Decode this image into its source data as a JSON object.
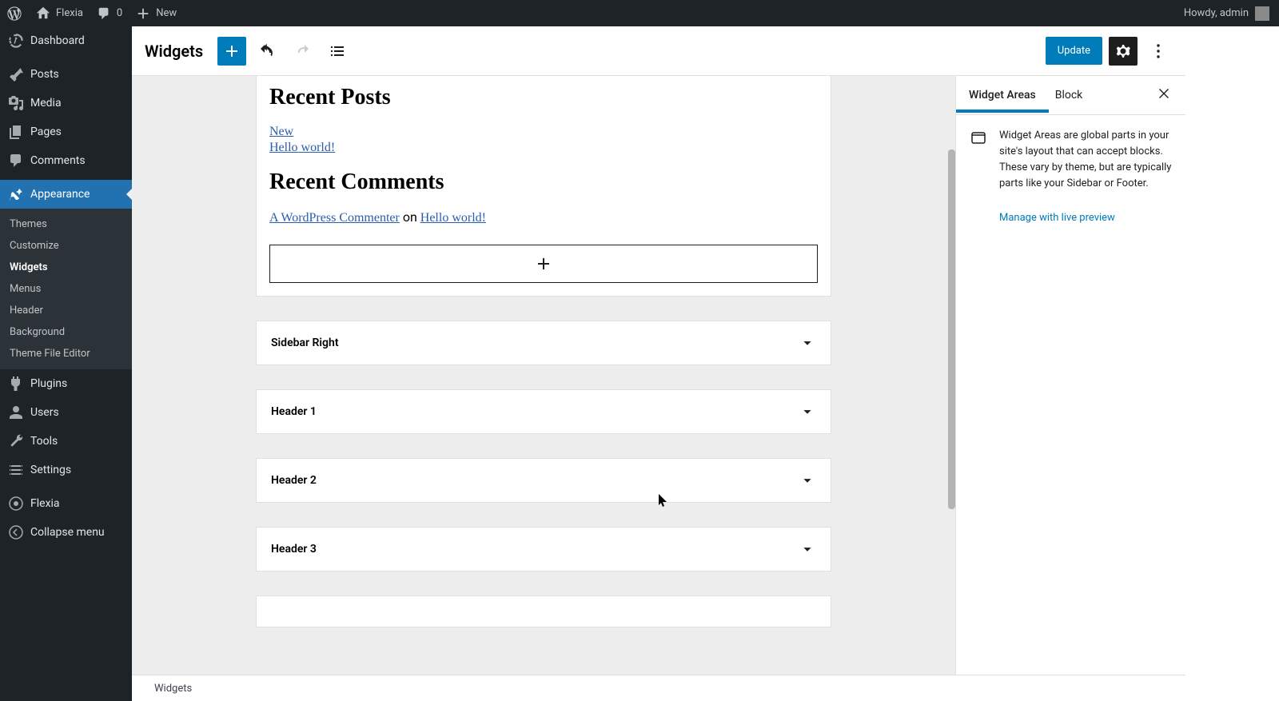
{
  "admin_bar": {
    "site_name": "Flexia",
    "comments_count": "0",
    "new_label": "New",
    "greeting": "Howdy, admin"
  },
  "admin_menu": {
    "dashboard": "Dashboard",
    "posts": "Posts",
    "media": "Media",
    "pages": "Pages",
    "comments": "Comments",
    "appearance": "Appearance",
    "appearance_sub": {
      "themes": "Themes",
      "customize": "Customize",
      "widgets": "Widgets",
      "menus": "Menus",
      "header": "Header",
      "background": "Background",
      "theme_file_editor": "Theme File Editor"
    },
    "plugins": "Plugins",
    "users": "Users",
    "tools": "Tools",
    "settings": "Settings",
    "flexia": "Flexia",
    "collapse": "Collapse menu"
  },
  "editor_header": {
    "title": "Widgets",
    "update_button": "Update"
  },
  "canvas": {
    "recent_posts_heading": "Recent Posts",
    "recent_posts": [
      "New",
      "Hello world!"
    ],
    "recent_comments_heading": "Recent Comments",
    "recent_comment": {
      "author": "A WordPress Commenter",
      "connector": " on ",
      "post": "Hello world!"
    },
    "areas": [
      "Sidebar Right",
      "Header 1",
      "Header 2",
      "Header 3"
    ]
  },
  "sidebar": {
    "tab_widget_areas": "Widget Areas",
    "tab_block": "Block",
    "description": "Widget Areas are global parts in your site's layout that can accept blocks. These vary by theme, but are typically parts like your Sidebar or Footer.",
    "manage_link": "Manage with live preview"
  },
  "status_bar": {
    "breadcrumb": "Widgets"
  }
}
